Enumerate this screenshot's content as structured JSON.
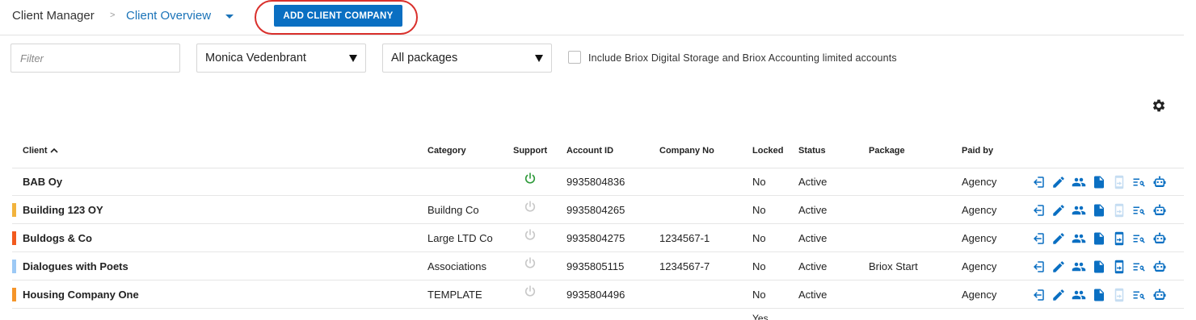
{
  "breadcrumb": {
    "root": "Client Manager",
    "separator": ">",
    "current": "Client Overview"
  },
  "toolbar": {
    "add_button_label": "ADD CLIENT COMPANY"
  },
  "filters": {
    "filter_placeholder": "Filter",
    "user_select": "Monica Vedenbrant",
    "package_select": "All packages",
    "include_label": "Include Briox Digital Storage and Briox Accounting limited accounts",
    "include_checked": false
  },
  "table": {
    "headers": {
      "client": "Client",
      "category": "Category",
      "support": "Support",
      "account_id": "Account ID",
      "company_no": "Company No",
      "locked": "Locked",
      "status": "Status",
      "package": "Package",
      "paid_by": "Paid by"
    },
    "rows": [
      {
        "client": "BAB Oy",
        "category": "",
        "support_active": true,
        "account_id": "9935804836",
        "company_no": "",
        "locked": "No",
        "status": "Active",
        "package": "",
        "paid_by": "Agency",
        "color": "",
        "device_enabled": false
      },
      {
        "client": "Building 123 OY",
        "category": "Buildng Co",
        "support_active": false,
        "account_id": "9935804265",
        "company_no": "",
        "locked": "No",
        "status": "Active",
        "package": "",
        "paid_by": "Agency",
        "color": "#f2b33d",
        "device_enabled": false
      },
      {
        "client": "Buldogs & Co",
        "category": "Large LTD Co",
        "support_active": false,
        "account_id": "9935804275",
        "company_no": "1234567-1",
        "locked": "No",
        "status": "Active",
        "package": "",
        "paid_by": "Agency",
        "color": "#f25a1e",
        "device_enabled": true
      },
      {
        "client": "Dialogues with Poets",
        "category": "Associations",
        "support_active": false,
        "account_id": "9935805115",
        "company_no": "1234567-7",
        "locked": "No",
        "status": "Active",
        "package": "Briox Start",
        "paid_by": "Agency",
        "color": "#9cc9f5",
        "device_enabled": true
      },
      {
        "client": "Housing Company One",
        "category": "TEMPLATE",
        "support_active": false,
        "account_id": "9935804496",
        "company_no": "",
        "locked": "No",
        "status": "Active",
        "package": "",
        "paid_by": "Agency",
        "color": "#f5952a",
        "device_enabled": false
      }
    ],
    "trailing_partial_text": "Yes"
  },
  "colors": {
    "accent": "#0a6fc2",
    "link": "#1a73b8",
    "support_on": "#2e9a3a",
    "support_off": "#c8c8c8",
    "highlight": "#d9302c"
  },
  "icons": {
    "settings": "gear-icon",
    "sort": "sort-ascending-icon",
    "support": "power-icon",
    "row_actions": [
      "login-icon",
      "edit-pencil-icon",
      "users-icon",
      "document-icon",
      "device-transfer-icon",
      "search-list-icon",
      "robot-icon"
    ]
  }
}
